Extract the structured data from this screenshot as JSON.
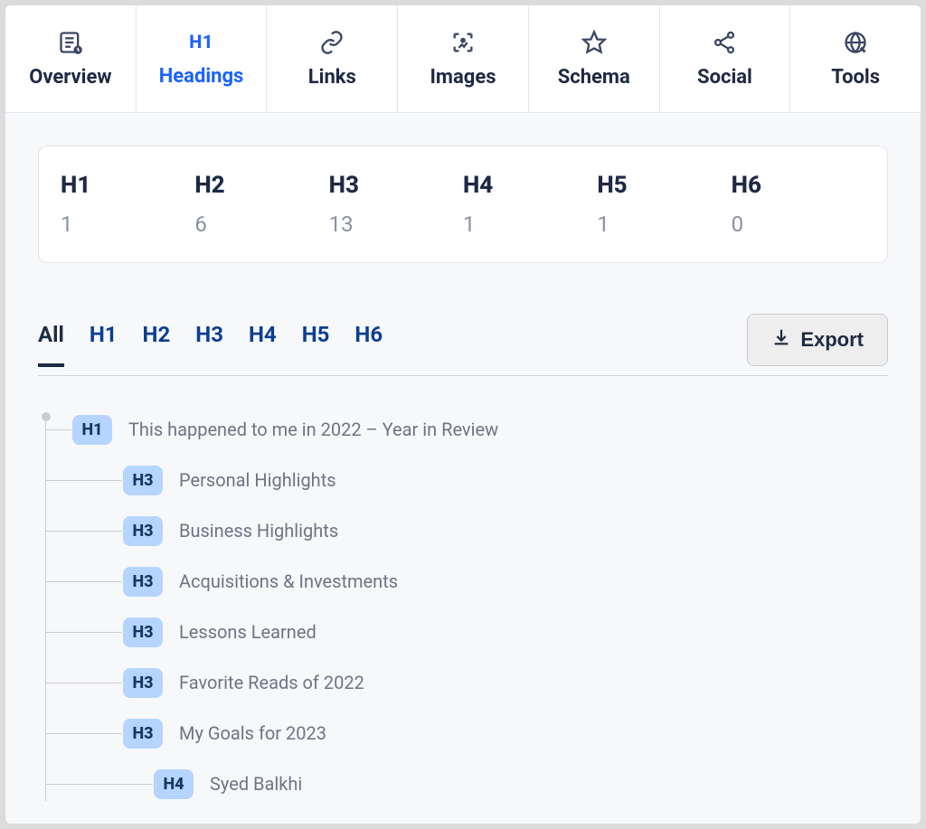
{
  "tabs": [
    {
      "label": "Overview",
      "icon": "overview"
    },
    {
      "label": "Headings",
      "icon": "h1",
      "active": true
    },
    {
      "label": "Links",
      "icon": "link"
    },
    {
      "label": "Images",
      "icon": "image"
    },
    {
      "label": "Schema",
      "icon": "star"
    },
    {
      "label": "Social",
      "icon": "share"
    },
    {
      "label": "Tools",
      "icon": "globe"
    }
  ],
  "summary": [
    {
      "label": "H1",
      "count": "1"
    },
    {
      "label": "H2",
      "count": "6"
    },
    {
      "label": "H3",
      "count": "13"
    },
    {
      "label": "H4",
      "count": "1"
    },
    {
      "label": "H5",
      "count": "1"
    },
    {
      "label": "H6",
      "count": "0"
    }
  ],
  "filters": [
    {
      "label": "All",
      "active": true
    },
    {
      "label": "H1"
    },
    {
      "label": "H2"
    },
    {
      "label": "H3"
    },
    {
      "label": "H4"
    },
    {
      "label": "H5"
    },
    {
      "label": "H6"
    }
  ],
  "export_label": "Export",
  "tree": [
    {
      "level": 1,
      "tag": "H1",
      "text": "This happened to me in 2022 – Year in Review"
    },
    {
      "level": 2,
      "tag": "H3",
      "text": "Personal Highlights"
    },
    {
      "level": 2,
      "tag": "H3",
      "text": "Business Highlights"
    },
    {
      "level": 2,
      "tag": "H3",
      "text": "Acquisitions & Investments"
    },
    {
      "level": 2,
      "tag": "H3",
      "text": "Lessons Learned"
    },
    {
      "level": 2,
      "tag": "H3",
      "text": "Favorite Reads of 2022"
    },
    {
      "level": 2,
      "tag": "H3",
      "text": "My Goals for 2023"
    },
    {
      "level": 3,
      "tag": "H4",
      "text": "Syed Balkhi"
    }
  ]
}
